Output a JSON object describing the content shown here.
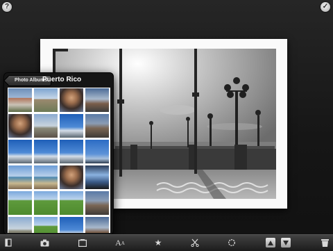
{
  "popover": {
    "back_label": "Photo Albums",
    "title": "Puerto Rico",
    "thumbnails": [
      {
        "scene": "building"
      },
      {
        "scene": "fort"
      },
      {
        "scene": "portrait"
      },
      {
        "scene": "people"
      },
      {
        "scene": "portrait"
      },
      {
        "scene": "street"
      },
      {
        "scene": "sky"
      },
      {
        "scene": "crowd"
      },
      {
        "scene": "sky"
      },
      {
        "scene": "sky"
      },
      {
        "scene": "sky"
      },
      {
        "scene": "pole"
      },
      {
        "scene": "beach"
      },
      {
        "scene": "beach"
      },
      {
        "scene": "portrait"
      },
      {
        "scene": "screen"
      },
      {
        "scene": "field"
      },
      {
        "scene": "field"
      },
      {
        "scene": "field"
      },
      {
        "scene": "crowd"
      },
      {
        "scene": "street"
      },
      {
        "scene": "field"
      },
      {
        "scene": "sky"
      },
      {
        "scene": "people"
      }
    ]
  },
  "toolbar": {
    "type_glyph": "A",
    "type_glyph_small": "A",
    "star_glyph": "★"
  }
}
